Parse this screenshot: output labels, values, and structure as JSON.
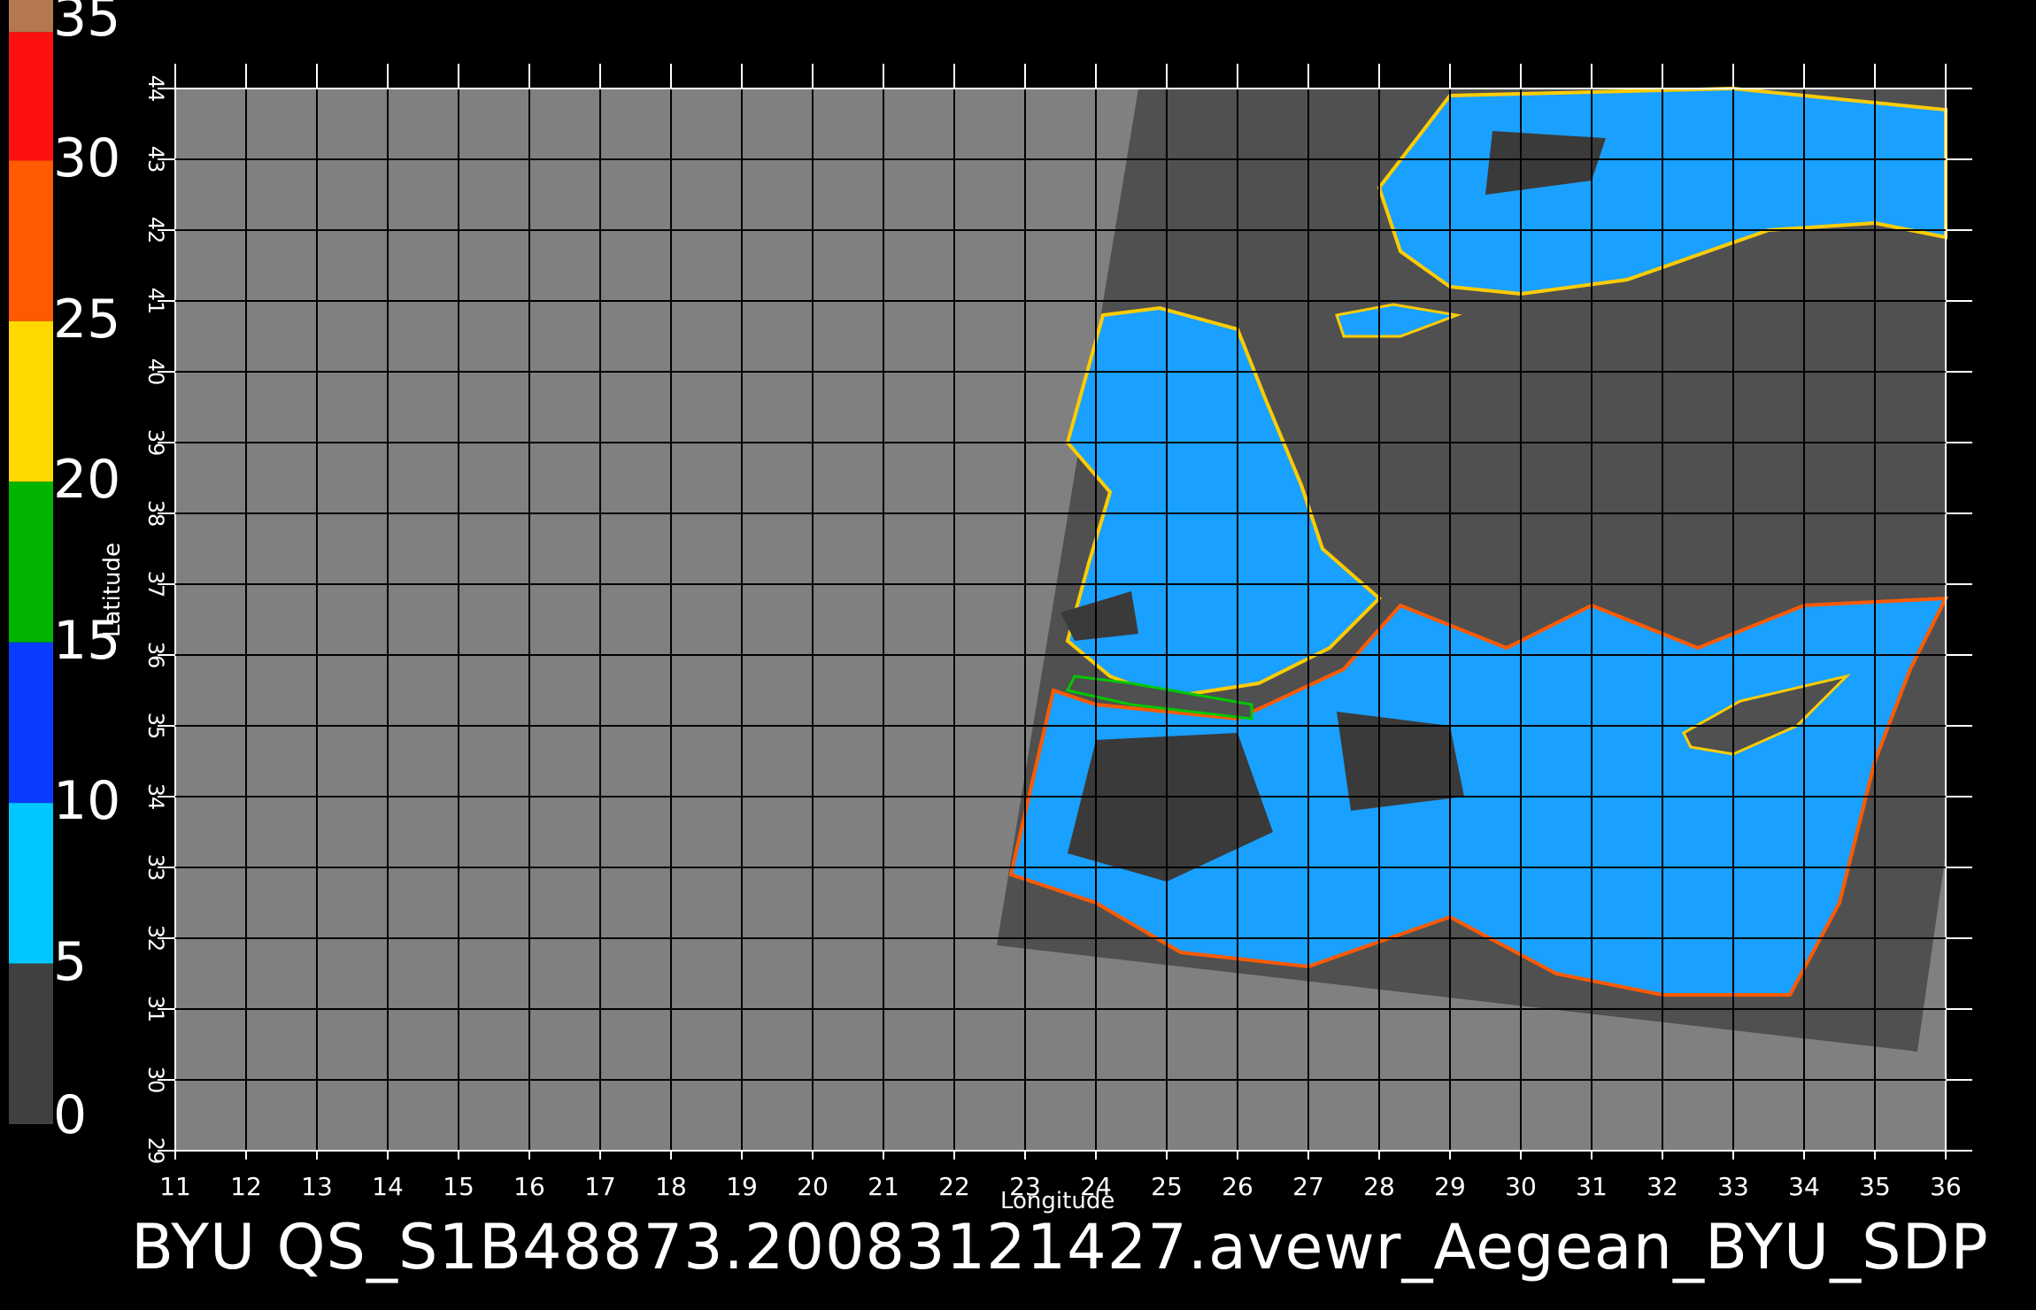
{
  "title": "BYU QS_S1B48873.20083121427.avewr_Aegean_BYU_SDP",
  "colorbar": {
    "ticks": [
      "35",
      "30",
      "25",
      "20",
      "15",
      "10",
      "5",
      "0"
    ],
    "bands": [
      {
        "from": 35,
        "to": 34,
        "color": "#b47850"
      },
      {
        "from": 34,
        "to": 30,
        "color": "#ff1010"
      },
      {
        "from": 30,
        "to": 25,
        "color": "#ff5a00"
      },
      {
        "from": 25,
        "to": 20,
        "color": "#ffd800"
      },
      {
        "from": 20,
        "to": 15,
        "color": "#00b400"
      },
      {
        "from": 15,
        "to": 10,
        "color": "#0a3cff"
      },
      {
        "from": 10,
        "to": 5,
        "color": "#00c8ff"
      },
      {
        "from": 5,
        "to": 0,
        "color": "#404040"
      }
    ]
  },
  "axes": {
    "x_label": "Longitude",
    "y_label": "Latitude",
    "x_ticks": [
      11,
      12,
      13,
      14,
      15,
      16,
      17,
      18,
      19,
      20,
      21,
      22,
      23,
      24,
      25,
      26,
      27,
      28,
      29,
      30,
      31,
      32,
      33,
      34,
      35,
      36
    ],
    "y_ticks": [
      29,
      30,
      31,
      32,
      33,
      34,
      35,
      36,
      37,
      38,
      39,
      40,
      41,
      42,
      43,
      44
    ],
    "x_range": [
      11,
      36
    ],
    "y_range": [
      29,
      44
    ]
  },
  "colors": {
    "land_gray": "#808080",
    "swath_dark": "#505050",
    "ocean_wind": "#1aa0ff",
    "grid": "#000000"
  }
}
